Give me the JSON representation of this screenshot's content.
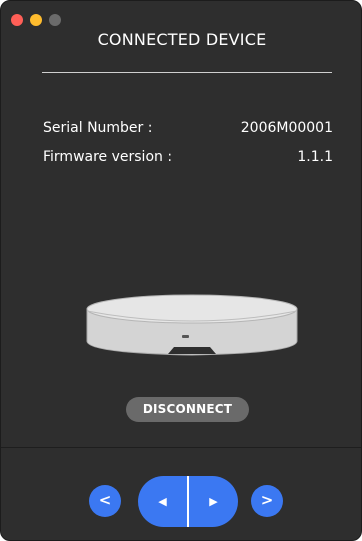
{
  "window": {
    "title": "CONNECTED DEVICE"
  },
  "info": {
    "serial_label": "Serial Number :",
    "serial_value": "2006M00001",
    "firmware_label": "Firmware version :",
    "firmware_value": "1.1.1"
  },
  "actions": {
    "disconnect_label": "DISCONNECT"
  },
  "nav": {
    "prev_label": "<",
    "next_label": ">",
    "rotate_left_label": "◀",
    "rotate_right_label": "▶"
  },
  "colors": {
    "background": "#2e2e2e",
    "accent": "#3b78f2",
    "button_gray": "#6a6a6a"
  },
  "icons": {
    "device": "turntable-device-icon"
  }
}
